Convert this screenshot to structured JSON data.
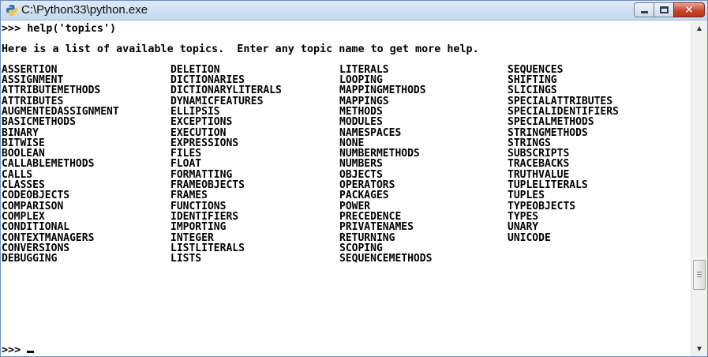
{
  "window": {
    "title": "C:\\Python33\\python.exe"
  },
  "console": {
    "command_line": ">>> help('topics')",
    "intro": "Here is a list of available topics.  Enter any topic name to get more help.",
    "columns": [
      [
        "ASSERTION",
        "ASSIGNMENT",
        "ATTRIBUTEMETHODS",
        "ATTRIBUTES",
        "AUGMENTEDASSIGNMENT",
        "BASICMETHODS",
        "BINARY",
        "BITWISE",
        "BOOLEAN",
        "CALLABLEMETHODS",
        "CALLS",
        "CLASSES",
        "CODEOBJECTS",
        "COMPARISON",
        "COMPLEX",
        "CONDITIONAL",
        "CONTEXTMANAGERS",
        "CONVERSIONS",
        "DEBUGGING"
      ],
      [
        "DELETION",
        "DICTIONARIES",
        "DICTIONARYLITERALS",
        "DYNAMICFEATURES",
        "ELLIPSIS",
        "EXCEPTIONS",
        "EXECUTION",
        "EXPRESSIONS",
        "FILES",
        "FLOAT",
        "FORMATTING",
        "FRAMEOBJECTS",
        "FRAMES",
        "FUNCTIONS",
        "IDENTIFIERS",
        "IMPORTING",
        "INTEGER",
        "LISTLITERALS",
        "LISTS"
      ],
      [
        "LITERALS",
        "LOOPING",
        "MAPPINGMETHODS",
        "MAPPINGS",
        "METHODS",
        "MODULES",
        "NAMESPACES",
        "NONE",
        "NUMBERMETHODS",
        "NUMBERS",
        "OBJECTS",
        "OPERATORS",
        "PACKAGES",
        "POWER",
        "PRECEDENCE",
        "PRIVATENAMES",
        "RETURNING",
        "SCOPING",
        "SEQUENCEMETHODS"
      ],
      [
        "SEQUENCES",
        "SHIFTING",
        "SLICINGS",
        "SPECIALATTRIBUTES",
        "SPECIALIDENTIFIERS",
        "SPECIALMETHODS",
        "STRINGMETHODS",
        "STRINGS",
        "SUBSCRIPTS",
        "TRACEBACKS",
        "TRUTHVALUE",
        "TUPLELITERALS",
        "TUPLES",
        "TYPEOBJECTS",
        "TYPES",
        "UNARY",
        "UNICODE"
      ]
    ],
    "final_prompt": ">>> "
  },
  "icons": {
    "app": "python-icon",
    "minimize": "minimize-icon",
    "maximize": "maximize-icon",
    "close": "close-icon",
    "scroll_up": "arrow-up-icon",
    "scroll_down": "arrow-down-icon"
  },
  "colors": {
    "titlebar": "#c6d9ef",
    "close_button": "#c9462f",
    "console_bg": "#ffffff",
    "console_text": "#000000"
  }
}
